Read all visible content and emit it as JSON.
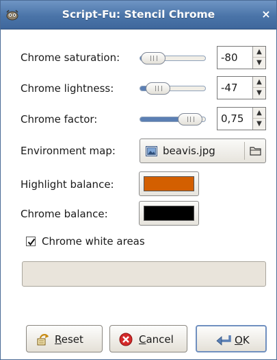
{
  "window": {
    "title": "Script-Fu: Stencil Chrome",
    "app_icon": "gimp-wilber-icon",
    "close_glyph": "×"
  },
  "fields": {
    "chrome_saturation": {
      "label": "Chrome saturation:",
      "value": "-80",
      "slider_fraction": 0.2
    },
    "chrome_lightness": {
      "label": "Chrome lightness:",
      "value": "-47",
      "slider_fraction": 0.27
    },
    "chrome_factor": {
      "label": "Chrome factor:",
      "value": "0,75",
      "slider_fraction": 0.75
    },
    "environment_map": {
      "label": "Environment map:",
      "file_name": "beavis.jpg"
    },
    "highlight_balance": {
      "label": "Highlight balance:",
      "color": "#d35f00"
    },
    "chrome_balance": {
      "label": "Chrome balance:",
      "color": "#000000"
    },
    "chrome_white_areas": {
      "label": "Chrome white areas",
      "checked": true
    }
  },
  "buttons": {
    "reset": {
      "label_prefix": "",
      "mnemonic": "R",
      "label_rest": "eset"
    },
    "cancel": {
      "label_prefix": "",
      "mnemonic": "C",
      "label_rest": "ancel"
    },
    "ok": {
      "label_prefix": "",
      "mnemonic": "O",
      "label_rest": "K"
    }
  },
  "colors": {
    "titlebar": "#4a74a8",
    "slider_fill": "#5b7fb3",
    "dialog_bg": "#ffffff"
  }
}
